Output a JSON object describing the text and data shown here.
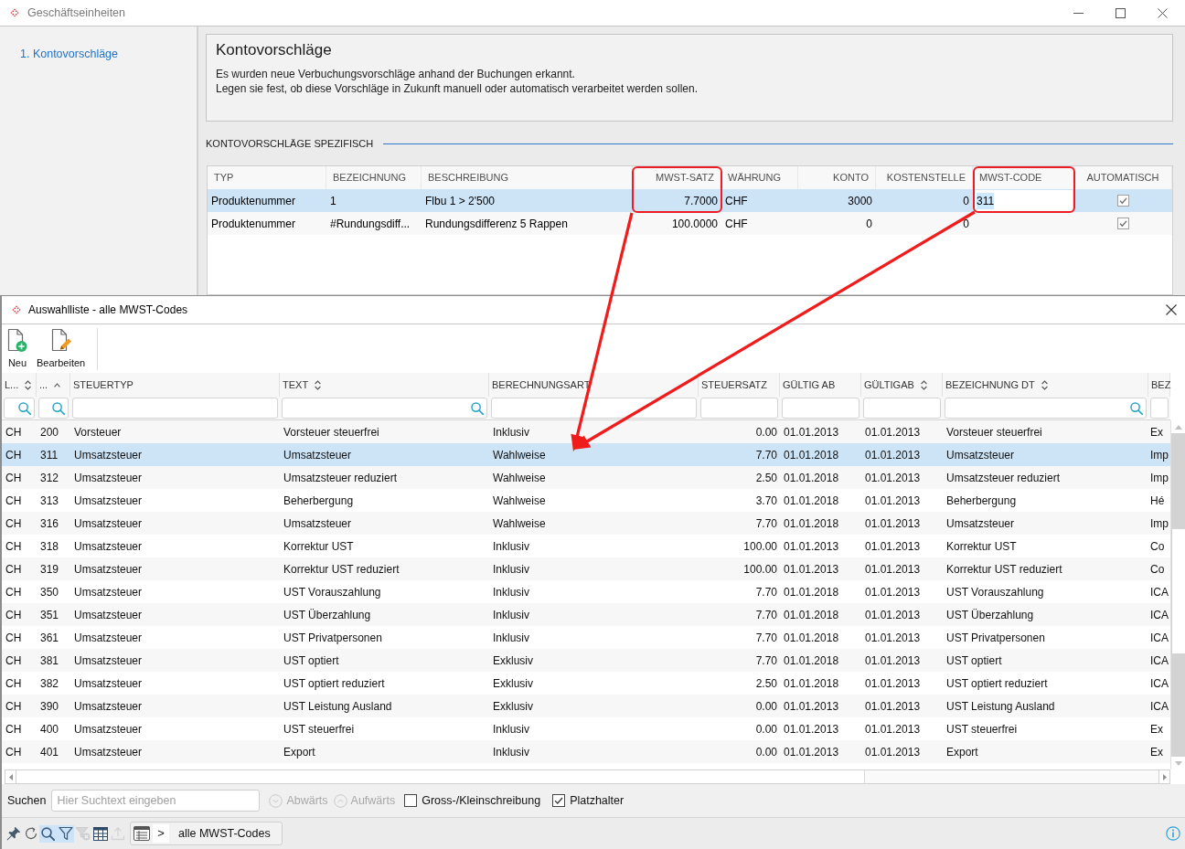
{
  "window": {
    "title": "Geschäftseinheiten"
  },
  "sidebar": {
    "items": [
      {
        "label": "1. Kontovorschläge",
        "selected": true
      }
    ]
  },
  "info_panel": {
    "title": "Kontovorschläge",
    "lines": [
      "Es wurden neue Verbuchungsvorschläge anhand der Buchungen erkannt.",
      "Legen sie fest, ob diese Vorschläge in Zukunft manuell oder automatisch verarbeitet werden sollen."
    ]
  },
  "suggestions": {
    "section_title": "KONTOVORSCHLÄGE SPEZIFISCH",
    "columns": [
      {
        "label": "TYP",
        "kind": "text"
      },
      {
        "label": "BEZEICHNUNG",
        "kind": "text"
      },
      {
        "label": "BESCHREIBUNG",
        "kind": "text"
      },
      {
        "label": "MWST-SATZ",
        "kind": "number"
      },
      {
        "label": "WÄHRUNG",
        "kind": "text"
      },
      {
        "label": "KONTO",
        "kind": "number"
      },
      {
        "label": "KOSTENSTELLE",
        "kind": "number"
      },
      {
        "label": "MWST-CODE",
        "kind": "text"
      },
      {
        "label": "AUTOMATISCH",
        "kind": "checkbox"
      }
    ],
    "rows": [
      {
        "selected": true,
        "automatisch": true,
        "cells": [
          {
            "text": "Produktenummer",
            "editing": false
          },
          {
            "text": "1",
            "editing": false
          },
          {
            "text": "Flbu 1 > 2'500",
            "editing": false
          },
          {
            "text": "7.7000",
            "editing": false
          },
          {
            "text": "CHF",
            "editing": false
          },
          {
            "text": "3000",
            "editing": false
          },
          {
            "text": "0",
            "editing": false
          },
          {
            "text": "311",
            "editing": true
          }
        ]
      },
      {
        "selected": false,
        "automatisch": true,
        "cells": [
          {
            "text": "Produktenummer",
            "editing": false
          },
          {
            "text": "#Rundungsdiff...",
            "editing": false
          },
          {
            "text": "Rundungsdifferenz 5 Rappen",
            "editing": false
          },
          {
            "text": "100.0000",
            "editing": false
          },
          {
            "text": "CHF",
            "editing": false
          },
          {
            "text": "0",
            "editing": false
          },
          {
            "text": "0",
            "editing": false
          }
        ]
      }
    ]
  },
  "dialog": {
    "title": "Auswahlliste - alle MWST-Codes",
    "toolbar": [
      {
        "label": "Neu",
        "kind": "new"
      },
      {
        "label": "Bearbeiten",
        "kind": "edit"
      }
    ],
    "table": {
      "columns": [
        {
          "label": "L...",
          "kind": "text",
          "sortable": true,
          "sorted_ascending": false,
          "filter_icon": true
        },
        {
          "label": "...",
          "kind": "text",
          "sortable": true,
          "sorted_ascending": true,
          "filter_icon": true
        },
        {
          "label": "STEUERTYP",
          "kind": "text",
          "sortable": false,
          "sorted_ascending": false,
          "filter_icon": false
        },
        {
          "label": "TEXT",
          "kind": "text",
          "sortable": true,
          "sorted_ascending": false,
          "filter_icon": true
        },
        {
          "label": "BERECHNUNGSART",
          "kind": "text",
          "sortable": false,
          "sorted_ascending": false,
          "filter_icon": false
        },
        {
          "label": "STEUERSATZ",
          "kind": "number",
          "sortable": false,
          "sorted_ascending": false,
          "filter_icon": false
        },
        {
          "label": "GÜLTIG AB",
          "kind": "text",
          "sortable": false,
          "sorted_ascending": false,
          "filter_icon": false
        },
        {
          "label": "GÜLTIGAB",
          "kind": "text",
          "sortable": true,
          "sorted_ascending": false,
          "filter_icon": false
        },
        {
          "label": "BEZEICHNUNG DT",
          "kind": "text",
          "sortable": true,
          "sorted_ascending": false,
          "filter_icon": true
        },
        {
          "label": "BEZ",
          "kind": "text",
          "sortable": false,
          "sorted_ascending": false,
          "filter_icon": false
        }
      ],
      "rows": [
        {
          "selected": false,
          "cells": [
            "CH",
            "200",
            "Vorsteuer",
            "Vorsteuer steuerfrei",
            "Inklusiv",
            "0.00",
            "01.01.2013",
            "01.01.2013",
            "Vorsteuer steuerfrei",
            "Ex"
          ]
        },
        {
          "selected": true,
          "cells": [
            "CH",
            "311",
            "Umsatzsteuer",
            "Umsatzsteuer",
            "Wahlweise",
            "7.70",
            "01.01.2018",
            "01.01.2013",
            "Umsatzsteuer",
            "Imp"
          ]
        },
        {
          "selected": false,
          "cells": [
            "CH",
            "312",
            "Umsatzsteuer",
            "Umsatzsteuer reduziert",
            "Wahlweise",
            "2.50",
            "01.01.2018",
            "01.01.2013",
            "Umsatzsteuer reduziert",
            "Imp"
          ]
        },
        {
          "selected": false,
          "cells": [
            "CH",
            "313",
            "Umsatzsteuer",
            "Beherbergung",
            "Wahlweise",
            "3.70",
            "01.01.2018",
            "01.01.2013",
            "Beherbergung",
            "Hé"
          ]
        },
        {
          "selected": false,
          "cells": [
            "CH",
            "316",
            "Umsatzsteuer",
            "Umsatzsteuer",
            "Wahlweise",
            "7.70",
            "01.01.2018",
            "01.01.2013",
            "Umsatzsteuer",
            "Imp"
          ]
        },
        {
          "selected": false,
          "cells": [
            "CH",
            "318",
            "Umsatzsteuer",
            "Korrektur UST",
            "Inklusiv",
            "100.00",
            "01.01.2013",
            "01.01.2013",
            "Korrektur UST",
            "Co"
          ]
        },
        {
          "selected": false,
          "cells": [
            "CH",
            "319",
            "Umsatzsteuer",
            "Korrektur UST reduziert",
            "Inklusiv",
            "100.00",
            "01.01.2013",
            "01.01.2013",
            "Korrektur UST reduziert",
            "Co"
          ]
        },
        {
          "selected": false,
          "cells": [
            "CH",
            "350",
            "Umsatzsteuer",
            "UST Vorauszahlung",
            "Inklusiv",
            "7.70",
            "01.01.2018",
            "01.01.2013",
            "UST Vorauszahlung",
            "ICA"
          ]
        },
        {
          "selected": false,
          "cells": [
            "CH",
            "351",
            "Umsatzsteuer",
            "UST Überzahlung",
            "Inklusiv",
            "7.70",
            "01.01.2018",
            "01.01.2013",
            "UST Überzahlung",
            "ICA"
          ]
        },
        {
          "selected": false,
          "cells": [
            "CH",
            "361",
            "Umsatzsteuer",
            "UST Privatpersonen",
            "Inklusiv",
            "7.70",
            "01.01.2018",
            "01.01.2013",
            "UST Privatpersonen",
            "ICA"
          ]
        },
        {
          "selected": false,
          "cells": [
            "CH",
            "381",
            "Umsatzsteuer",
            "UST optiert",
            "Exklusiv",
            "7.70",
            "01.01.2018",
            "01.01.2013",
            "UST optiert",
            "ICA"
          ]
        },
        {
          "selected": false,
          "cells": [
            "CH",
            "382",
            "Umsatzsteuer",
            "UST optiert reduziert",
            "Exklusiv",
            "2.50",
            "01.01.2018",
            "01.01.2013",
            "UST optiert reduziert",
            "ICA"
          ]
        },
        {
          "selected": false,
          "cells": [
            "CH",
            "390",
            "Umsatzsteuer",
            "UST Leistung Ausland",
            "Exklusiv",
            "0.00",
            "01.01.2013",
            "01.01.2013",
            "UST Leistung Ausland",
            "ICA"
          ]
        },
        {
          "selected": false,
          "cells": [
            "CH",
            "400",
            "Umsatzsteuer",
            "UST steuerfrei",
            "Inklusiv",
            "0.00",
            "01.01.2013",
            "01.01.2013",
            "UST steuerfrei",
            "Ex"
          ]
        },
        {
          "selected": false,
          "cells": [
            "CH",
            "401",
            "Umsatzsteuer",
            "Export",
            "Inklusiv",
            "0.00",
            "01.01.2013",
            "01.01.2013",
            "Export",
            "Ex"
          ]
        }
      ]
    },
    "search_bar": {
      "label": "Suchen",
      "placeholder": "Hier Suchtext eingeben",
      "directions": [
        {
          "label": "Abwärts",
          "kind": "down",
          "disabled": true
        },
        {
          "label": "Aufwärts",
          "kind": "up",
          "disabled": true
        }
      ],
      "options": [
        {
          "label": "Gross-/Kleinschreibung",
          "checked": false
        },
        {
          "label": "Platzhalter",
          "checked": true
        }
      ]
    },
    "bottom_bar": {
      "tools": [
        {
          "kind": "pin",
          "active": false,
          "disabled": false
        },
        {
          "kind": "refresh",
          "active": false,
          "disabled": false
        },
        {
          "kind": "search",
          "active": true,
          "disabled": false
        },
        {
          "kind": "filter",
          "active": true,
          "disabled": false
        },
        {
          "kind": "clear_filter",
          "active": false,
          "disabled": true
        },
        {
          "kind": "columns",
          "active": false,
          "disabled": false
        },
        {
          "kind": "export",
          "active": false,
          "disabled": true
        }
      ],
      "breadcrumb": {
        "separator": ">",
        "label": "alle MWST-Codes"
      }
    }
  }
}
